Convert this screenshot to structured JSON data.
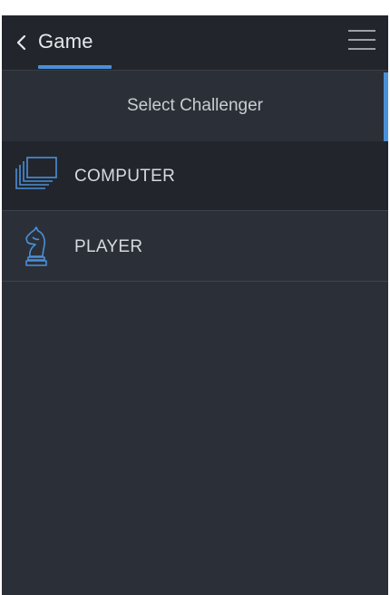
{
  "header": {
    "back_icon": "chevron-left-icon",
    "title": "Game",
    "menu_icon": "hamburger-menu-icon"
  },
  "main": {
    "subtitle": "Select Challenger",
    "items": [
      {
        "label": "COMPUTER",
        "icon": "computer-stack-icon"
      },
      {
        "label": "PLAYER",
        "icon": "chess-knight-icon"
      }
    ]
  },
  "colors": {
    "accent": "#4a90d9",
    "header_bg": "#22262c",
    "content_bg": "#2b3038",
    "text": "#d6dade"
  }
}
